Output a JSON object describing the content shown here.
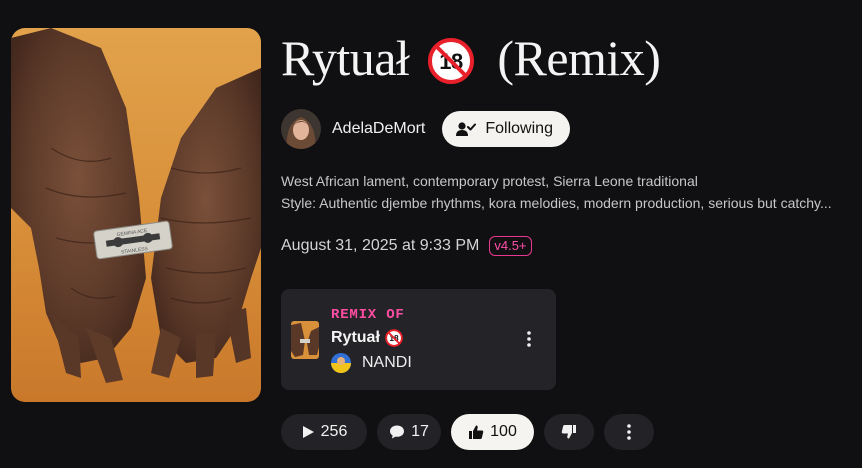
{
  "song": {
    "title_main": "Rytuał",
    "title_suffix": "(Remix)"
  },
  "artist": {
    "name": "AdelaDeMort",
    "follow_label": "Following"
  },
  "description": {
    "line1": "West African lament, contemporary protest, Sierra Leone traditional",
    "line2": "Style: Authentic djembe rhythms, kora melodies, modern production, serious but catchy..."
  },
  "meta": {
    "date": "August 31, 2025 at 9:33 PM",
    "version": "v4.5+"
  },
  "remix": {
    "label": "REMIX OF",
    "song_title": "Rytuał",
    "artist_name": "NANDI"
  },
  "stats": {
    "plays": "256",
    "comments": "17",
    "likes": "100"
  },
  "icons": {
    "age": "18-plus-icon",
    "follow": "user-check-icon",
    "play": "play-icon",
    "comment": "comment-icon",
    "like": "thumbs-up-icon",
    "dislike": "thumbs-down-icon",
    "more": "more-vertical-icon"
  },
  "colors": {
    "background": "#101012",
    "accent": "#ff4da3",
    "card": "#242428",
    "pill": "#232327",
    "pill_active": "#f6f4f0"
  }
}
